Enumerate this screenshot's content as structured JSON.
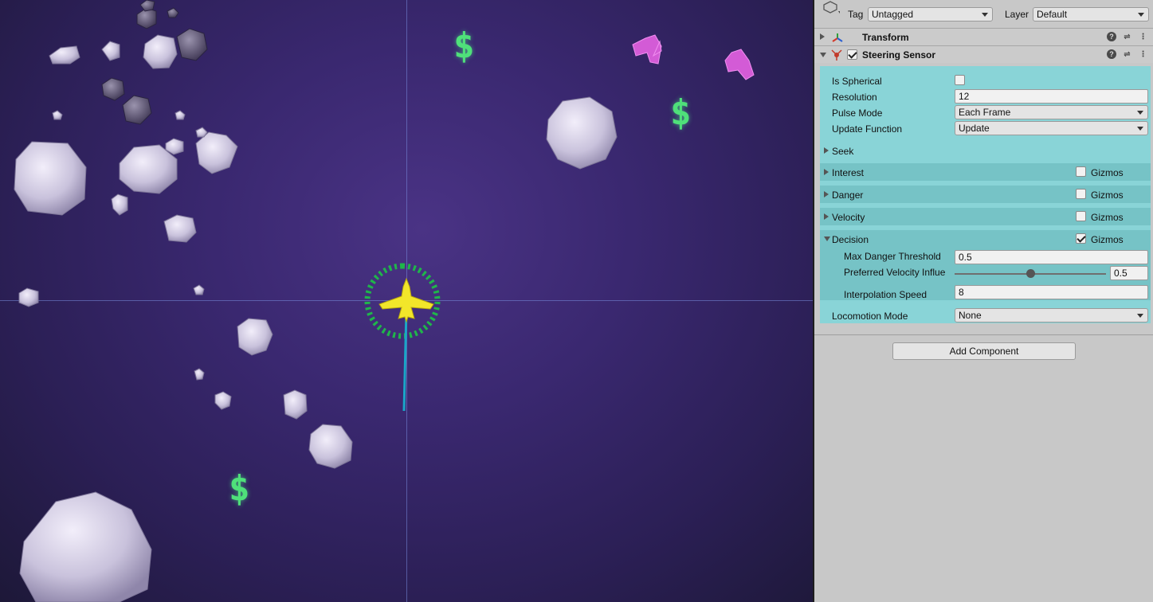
{
  "scene": {
    "currency_symbol": "$",
    "colors": {
      "background": "#3a2870",
      "currency": "#4fe07a",
      "player": "#f2e62a",
      "enemy": "#d35bd6",
      "sensor_ring": "#1fb64a",
      "velocity_line": "#1aa6c8",
      "asteroid": "#d9d4e6"
    }
  },
  "inspector": {
    "tag_label": "Tag",
    "tag_value": "Untagged",
    "layer_label": "Layer",
    "layer_value": "Default",
    "transform": {
      "title": "Transform"
    },
    "sensor": {
      "title": "Steering Sensor",
      "enabled": true,
      "is_spherical_label": "Is Spherical",
      "is_spherical": false,
      "resolution_label": "Resolution",
      "resolution": "12",
      "pulse_mode_label": "Pulse Mode",
      "pulse_mode": "Each Frame",
      "update_function_label": "Update Function",
      "update_function": "Update",
      "seek_label": "Seek",
      "interest_label": "Interest",
      "danger_label": "Danger",
      "velocity_label": "Velocity",
      "decision_label": "Decision",
      "gizmos_label": "Gizmos",
      "interest_gizmos": false,
      "danger_gizmos": false,
      "velocity_gizmos": false,
      "decision_gizmos": true,
      "max_danger_label": "Max Danger Threshold",
      "max_danger": "0.5",
      "pref_velocity_label": "Preferred Velocity Influe",
      "pref_velocity": "0.5",
      "pref_velocity_fraction": 0.5,
      "interp_speed_label": "Interpolation Speed",
      "interp_speed": "8",
      "locomotion_label": "Locomotion Mode",
      "locomotion": "None"
    },
    "add_component": "Add Component"
  }
}
